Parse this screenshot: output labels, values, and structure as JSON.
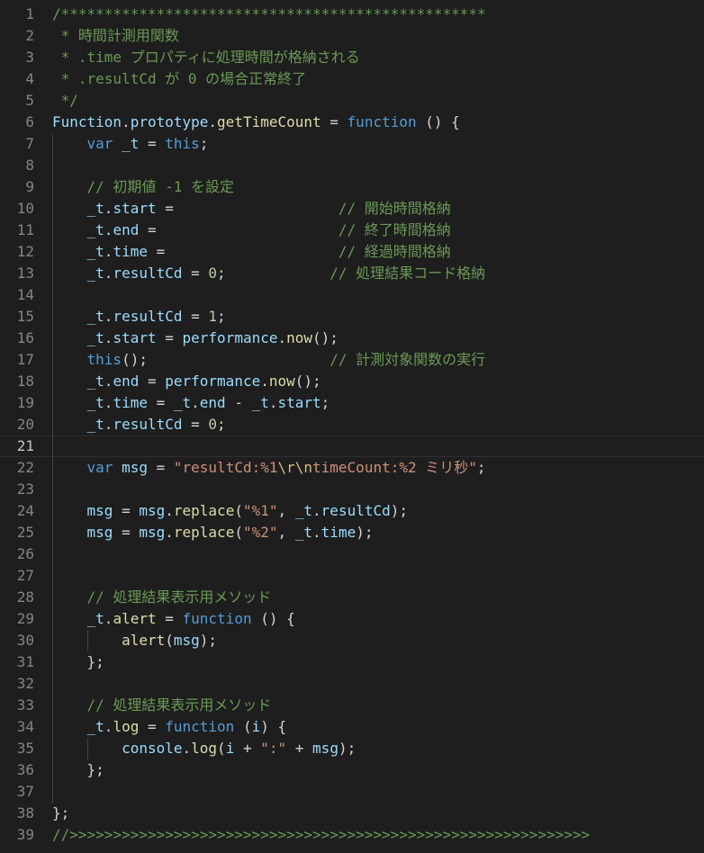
{
  "editor": {
    "language": "javascript",
    "theme_colors": {
      "background": "#1e1e1e",
      "comment": "#6a9955",
      "keyword": "#569cd6",
      "variable": "#9cdcfe",
      "function": "#dcdcaa",
      "string": "#ce9178",
      "number": "#b5cea8",
      "line_number": "#858585"
    },
    "active_line": 21,
    "lines": [
      {
        "n": "1",
        "tokens": [
          [
            "c",
            "/*************************************************"
          ]
        ]
      },
      {
        "n": "2",
        "tokens": [
          [
            "c",
            " * 時間計測用関数"
          ]
        ]
      },
      {
        "n": "3",
        "tokens": [
          [
            "c",
            " * .time プロパティに処理時間が格納される"
          ]
        ]
      },
      {
        "n": "4",
        "tokens": [
          [
            "c",
            " * .resultCd が 0 の場合正常終了"
          ]
        ]
      },
      {
        "n": "5",
        "tokens": [
          [
            "c",
            " */"
          ]
        ]
      },
      {
        "n": "6",
        "tokens": [
          [
            "v",
            "Function"
          ],
          [
            "p",
            "."
          ],
          [
            "v",
            "prototype"
          ],
          [
            "p",
            "."
          ],
          [
            "f",
            "getTimeCount"
          ],
          [
            "p",
            " = "
          ],
          [
            "k",
            "function"
          ],
          [
            "p",
            " () {"
          ]
        ]
      },
      {
        "n": "7",
        "tokens": [
          [
            "p",
            "    "
          ],
          [
            "k",
            "var"
          ],
          [
            "p",
            " "
          ],
          [
            "v",
            "_t"
          ],
          [
            "p",
            " = "
          ],
          [
            "k",
            "this"
          ],
          [
            "p",
            ";"
          ]
        ]
      },
      {
        "n": "8",
        "tokens": []
      },
      {
        "n": "9",
        "tokens": [
          [
            "p",
            "    "
          ],
          [
            "c",
            "// 初期値 -1 を設定"
          ]
        ]
      },
      {
        "n": "10",
        "tokens": [
          [
            "p",
            "    "
          ],
          [
            "v",
            "_t"
          ],
          [
            "p",
            "."
          ],
          [
            "v",
            "start"
          ],
          [
            "p",
            " =                   "
          ],
          [
            "c",
            "// 開始時間格納"
          ]
        ]
      },
      {
        "n": "11",
        "tokens": [
          [
            "p",
            "    "
          ],
          [
            "v",
            "_t"
          ],
          [
            "p",
            "."
          ],
          [
            "v",
            "end"
          ],
          [
            "p",
            " =                     "
          ],
          [
            "c",
            "// 終了時間格納"
          ]
        ]
      },
      {
        "n": "12",
        "tokens": [
          [
            "p",
            "    "
          ],
          [
            "v",
            "_t"
          ],
          [
            "p",
            "."
          ],
          [
            "v",
            "time"
          ],
          [
            "p",
            " =                    "
          ],
          [
            "c",
            "// 経過時間格納"
          ]
        ]
      },
      {
        "n": "13",
        "tokens": [
          [
            "p",
            "    "
          ],
          [
            "v",
            "_t"
          ],
          [
            "p",
            "."
          ],
          [
            "v",
            "resultCd"
          ],
          [
            "p",
            " = "
          ],
          [
            "n",
            "0"
          ],
          [
            "p",
            ";            "
          ],
          [
            "c",
            "// 処理結果コード格納"
          ]
        ]
      },
      {
        "n": "14",
        "tokens": []
      },
      {
        "n": "15",
        "tokens": [
          [
            "p",
            "    "
          ],
          [
            "v",
            "_t"
          ],
          [
            "p",
            "."
          ],
          [
            "v",
            "resultCd"
          ],
          [
            "p",
            " = "
          ],
          [
            "n",
            "1"
          ],
          [
            "p",
            ";"
          ]
        ]
      },
      {
        "n": "16",
        "tokens": [
          [
            "p",
            "    "
          ],
          [
            "v",
            "_t"
          ],
          [
            "p",
            "."
          ],
          [
            "v",
            "start"
          ],
          [
            "p",
            " = "
          ],
          [
            "v",
            "performance"
          ],
          [
            "p",
            "."
          ],
          [
            "f",
            "now"
          ],
          [
            "p",
            "();"
          ]
        ]
      },
      {
        "n": "17",
        "tokens": [
          [
            "p",
            "    "
          ],
          [
            "k",
            "this"
          ],
          [
            "p",
            "();                     "
          ],
          [
            "c",
            "// 計測対象関数の実行"
          ]
        ]
      },
      {
        "n": "18",
        "tokens": [
          [
            "p",
            "    "
          ],
          [
            "v",
            "_t"
          ],
          [
            "p",
            "."
          ],
          [
            "v",
            "end"
          ],
          [
            "p",
            " = "
          ],
          [
            "v",
            "performance"
          ],
          [
            "p",
            "."
          ],
          [
            "f",
            "now"
          ],
          [
            "p",
            "();"
          ]
        ]
      },
      {
        "n": "19",
        "tokens": [
          [
            "p",
            "    "
          ],
          [
            "v",
            "_t"
          ],
          [
            "p",
            "."
          ],
          [
            "v",
            "time"
          ],
          [
            "p",
            " = "
          ],
          [
            "v",
            "_t"
          ],
          [
            "p",
            "."
          ],
          [
            "v",
            "end"
          ],
          [
            "p",
            " - "
          ],
          [
            "v",
            "_t"
          ],
          [
            "p",
            "."
          ],
          [
            "v",
            "start"
          ],
          [
            "p",
            ";"
          ]
        ]
      },
      {
        "n": "20",
        "tokens": [
          [
            "p",
            "    "
          ],
          [
            "v",
            "_t"
          ],
          [
            "p",
            "."
          ],
          [
            "v",
            "resultCd"
          ],
          [
            "p",
            " = "
          ],
          [
            "n",
            "0"
          ],
          [
            "p",
            ";"
          ]
        ]
      },
      {
        "n": "21",
        "tokens": []
      },
      {
        "n": "22",
        "tokens": [
          [
            "p",
            "    "
          ],
          [
            "k",
            "var"
          ],
          [
            "p",
            " "
          ],
          [
            "v",
            "msg"
          ],
          [
            "p",
            " = "
          ],
          [
            "s",
            "\"resultCd:%1"
          ],
          [
            "e",
            "\\r\\n"
          ],
          [
            "s",
            "timeCount:%2 ミリ秒\""
          ],
          [
            "p",
            ";"
          ]
        ]
      },
      {
        "n": "23",
        "tokens": []
      },
      {
        "n": "24",
        "tokens": [
          [
            "p",
            "    "
          ],
          [
            "v",
            "msg"
          ],
          [
            "p",
            " = "
          ],
          [
            "v",
            "msg"
          ],
          [
            "p",
            "."
          ],
          [
            "f",
            "replace"
          ],
          [
            "p",
            "("
          ],
          [
            "s",
            "\"%1\""
          ],
          [
            "p",
            ", "
          ],
          [
            "v",
            "_t"
          ],
          [
            "p",
            "."
          ],
          [
            "v",
            "resultCd"
          ],
          [
            "p",
            ");"
          ]
        ]
      },
      {
        "n": "25",
        "tokens": [
          [
            "p",
            "    "
          ],
          [
            "v",
            "msg"
          ],
          [
            "p",
            " = "
          ],
          [
            "v",
            "msg"
          ],
          [
            "p",
            "."
          ],
          [
            "f",
            "replace"
          ],
          [
            "p",
            "("
          ],
          [
            "s",
            "\"%2\""
          ],
          [
            "p",
            ", "
          ],
          [
            "v",
            "_t"
          ],
          [
            "p",
            "."
          ],
          [
            "v",
            "time"
          ],
          [
            "p",
            ");"
          ]
        ]
      },
      {
        "n": "26",
        "tokens": []
      },
      {
        "n": "27",
        "tokens": []
      },
      {
        "n": "28",
        "tokens": [
          [
            "p",
            "    "
          ],
          [
            "c",
            "// 処理結果表示用メソッド"
          ]
        ]
      },
      {
        "n": "29",
        "tokens": [
          [
            "p",
            "    "
          ],
          [
            "v",
            "_t"
          ],
          [
            "p",
            "."
          ],
          [
            "f",
            "alert"
          ],
          [
            "p",
            " = "
          ],
          [
            "k",
            "function"
          ],
          [
            "p",
            " () {"
          ]
        ]
      },
      {
        "n": "30",
        "tokens": [
          [
            "p",
            "        "
          ],
          [
            "f",
            "alert"
          ],
          [
            "p",
            "("
          ],
          [
            "v",
            "msg"
          ],
          [
            "p",
            ");"
          ]
        ]
      },
      {
        "n": "31",
        "tokens": [
          [
            "p",
            "    };"
          ]
        ]
      },
      {
        "n": "32",
        "tokens": []
      },
      {
        "n": "33",
        "tokens": [
          [
            "p",
            "    "
          ],
          [
            "c",
            "// 処理結果表示用メソッド"
          ]
        ]
      },
      {
        "n": "34",
        "tokens": [
          [
            "p",
            "    "
          ],
          [
            "v",
            "_t"
          ],
          [
            "p",
            "."
          ],
          [
            "f",
            "log"
          ],
          [
            "p",
            " = "
          ],
          [
            "k",
            "function"
          ],
          [
            "p",
            " ("
          ],
          [
            "v",
            "i"
          ],
          [
            "p",
            ") {"
          ]
        ]
      },
      {
        "n": "35",
        "tokens": [
          [
            "p",
            "        "
          ],
          [
            "v",
            "console"
          ],
          [
            "p",
            "."
          ],
          [
            "f",
            "log"
          ],
          [
            "p",
            "("
          ],
          [
            "v",
            "i"
          ],
          [
            "p",
            " + "
          ],
          [
            "s",
            "\":\""
          ],
          [
            "p",
            " + "
          ],
          [
            "v",
            "msg"
          ],
          [
            "p",
            ");"
          ]
        ]
      },
      {
        "n": "36",
        "tokens": [
          [
            "p",
            "    };"
          ]
        ]
      },
      {
        "n": "37",
        "tokens": []
      },
      {
        "n": "38",
        "tokens": [
          [
            "p",
            "};"
          ]
        ]
      },
      {
        "n": "39",
        "tokens": [
          [
            "c",
            "//>>>>>>>>>>>>>>>>>>>>>>>>>>>>>>>>>>>>>>>>>>>>>>>>>>>>>>>>>>>>"
          ]
        ]
      }
    ]
  }
}
